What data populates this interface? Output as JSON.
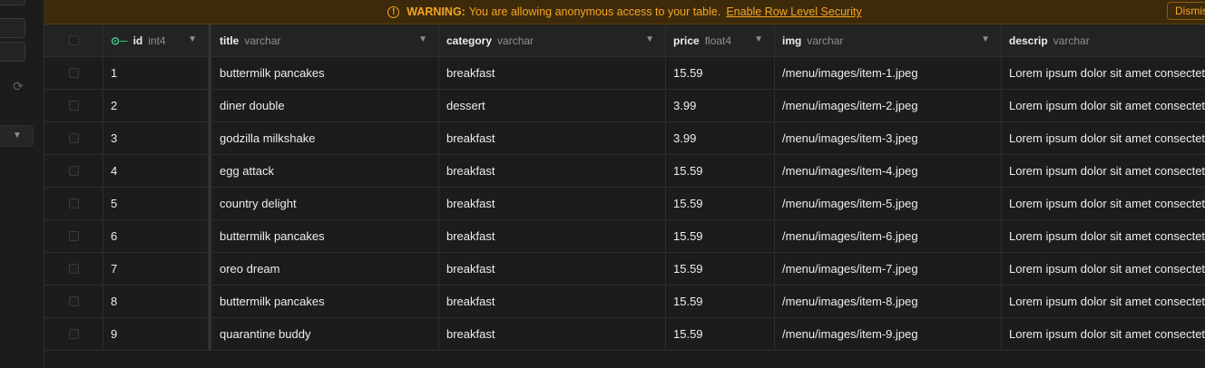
{
  "banner": {
    "warning_label": "WARNING:",
    "message": "You are allowing anonymous access to your table.",
    "link": "Enable Row Level Security",
    "dismiss": "Dismiss"
  },
  "columns": [
    {
      "name": "id",
      "type": "int4",
      "icon": "key-icon"
    },
    {
      "name": "title",
      "type": "varchar"
    },
    {
      "name": "category",
      "type": "varchar"
    },
    {
      "name": "price",
      "type": "float4"
    },
    {
      "name": "img",
      "type": "varchar"
    },
    {
      "name": "descrip",
      "type": "varchar"
    }
  ],
  "rows": [
    {
      "id": "1",
      "title": "buttermilk pancakes",
      "category": "breakfast",
      "price": "15.59",
      "img": "/menu/images/item-1.jpeg",
      "descrip": "Lorem ipsum dolor sit amet consectetur"
    },
    {
      "id": "2",
      "title": "diner double",
      "category": "dessert",
      "price": "3.99",
      "img": "/menu/images/item-2.jpeg",
      "descrip": "Lorem ipsum dolor sit amet consectetur"
    },
    {
      "id": "3",
      "title": "godzilla milkshake",
      "category": "breakfast",
      "price": "3.99",
      "img": "/menu/images/item-3.jpeg",
      "descrip": "Lorem ipsum dolor sit amet consectetur"
    },
    {
      "id": "4",
      "title": "egg attack",
      "category": "breakfast",
      "price": "15.59",
      "img": "/menu/images/item-4.jpeg",
      "descrip": "Lorem ipsum dolor sit amet consectetur"
    },
    {
      "id": "5",
      "title": "country delight",
      "category": "breakfast",
      "price": "15.59",
      "img": "/menu/images/item-5.jpeg",
      "descrip": "Lorem ipsum dolor sit amet consectetur"
    },
    {
      "id": "6",
      "title": "buttermilk pancakes",
      "category": "breakfast",
      "price": "15.59",
      "img": "/menu/images/item-6.jpeg",
      "descrip": "Lorem ipsum dolor sit amet consectetur"
    },
    {
      "id": "7",
      "title": "oreo dream",
      "category": "breakfast",
      "price": "15.59",
      "img": "/menu/images/item-7.jpeg",
      "descrip": "Lorem ipsum dolor sit amet consectetur"
    },
    {
      "id": "8",
      "title": "buttermilk pancakes",
      "category": "breakfast",
      "price": "15.59",
      "img": "/menu/images/item-8.jpeg",
      "descrip": "Lorem ipsum dolor sit amet consectetur"
    },
    {
      "id": "9",
      "title": "quarantine buddy",
      "category": "breakfast",
      "price": "15.59",
      "img": "/menu/images/item-9.jpeg",
      "descrip": "Lorem ipsum dolor sit amet consectetur"
    }
  ],
  "colors": {
    "warning": "#f5a524",
    "accent": "#3ecf8e",
    "background": "#1c1c1c"
  }
}
